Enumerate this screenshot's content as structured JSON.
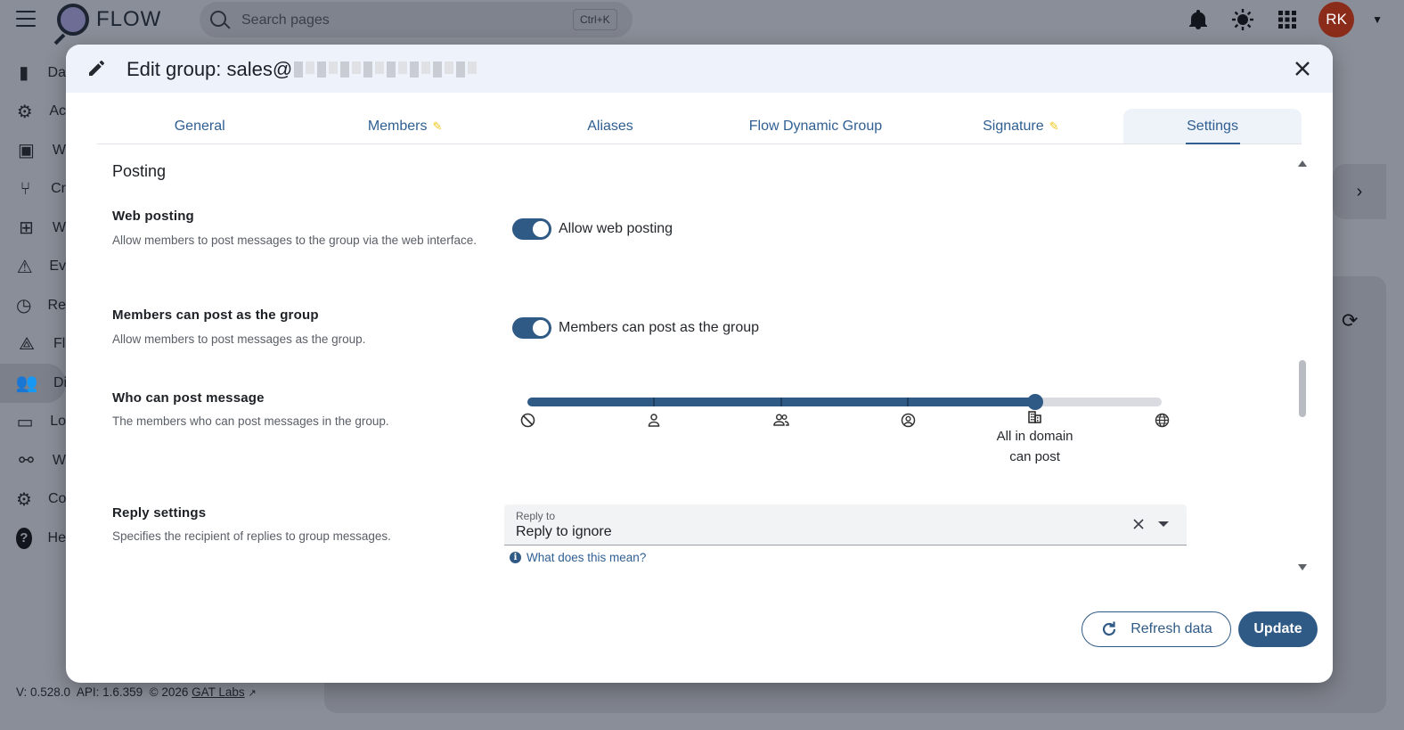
{
  "app": {
    "name": "FLOW",
    "search_placeholder": "Search pages",
    "search_shortcut": "Ctrl+K",
    "user_initials": "RK"
  },
  "sidebar": {
    "items": [
      {
        "label": "Da",
        "icon": "bar-chart-icon"
      },
      {
        "label": "Ac",
        "icon": "account-gear-icon"
      },
      {
        "label": "W",
        "icon": "window-code-icon"
      },
      {
        "label": "Cr",
        "icon": "fork-icon"
      },
      {
        "label": "W",
        "icon": "sitemap-icon"
      },
      {
        "label": "Ev",
        "icon": "alarm-light-icon"
      },
      {
        "label": "Re",
        "icon": "clock-icon"
      },
      {
        "label": "Fl",
        "icon": "graph-icon"
      },
      {
        "label": "Di",
        "icon": "users-icon"
      },
      {
        "label": "Lo",
        "icon": "card-icon"
      },
      {
        "label": "W",
        "icon": "webhook-icon"
      },
      {
        "label": "Co",
        "icon": "gear-icon"
      },
      {
        "label": "He",
        "icon": "help-icon"
      }
    ],
    "active_index": 8
  },
  "footer": {
    "version": "V: 0.528.0",
    "api": "API: 1.6.359",
    "copyright": "© 2026",
    "company": "GAT Labs"
  },
  "dialog": {
    "title": "Edit group: sales@",
    "tabs": [
      {
        "label": "General",
        "edited": false
      },
      {
        "label": "Members",
        "edited": true
      },
      {
        "label": "Aliases",
        "edited": false
      },
      {
        "label": "Flow Dynamic Group",
        "edited": false
      },
      {
        "label": "Signature",
        "edited": true
      },
      {
        "label": "Settings",
        "edited": false,
        "active": true
      }
    ],
    "section": "Posting",
    "web_posting": {
      "title": "Web posting",
      "description": "Allow members to post messages to the group via the web interface.",
      "toggle_label": "Allow web posting",
      "enabled": true
    },
    "post_as_group": {
      "title": "Members can post as the group",
      "description": "Allow members to post messages as the group.",
      "toggle_label": "Members can post as the group",
      "enabled": true
    },
    "who_can_post": {
      "title": "Who can post message",
      "description": "The members who can post messages in the group.",
      "levels": [
        {
          "icon": "block-icon"
        },
        {
          "icon": "person-icon"
        },
        {
          "icon": "people-icon"
        },
        {
          "icon": "account-circle-icon"
        },
        {
          "icon": "domain-icon"
        },
        {
          "icon": "globe-icon"
        }
      ],
      "selected_index": 4,
      "selected_label_line1": "All in domain",
      "selected_label_line2": "can post"
    },
    "reply_settings": {
      "title": "Reply settings",
      "description": "Specifies the recipient of replies to group messages.",
      "field_label": "Reply to",
      "value": "Reply to ignore",
      "help_link": "What does this mean?"
    },
    "buttons": {
      "refresh": "Refresh data",
      "update": "Update"
    },
    "colors": {
      "primary": "#2f5a86",
      "link": "#2f5f92",
      "edit_marker": "#f2c81f"
    }
  }
}
